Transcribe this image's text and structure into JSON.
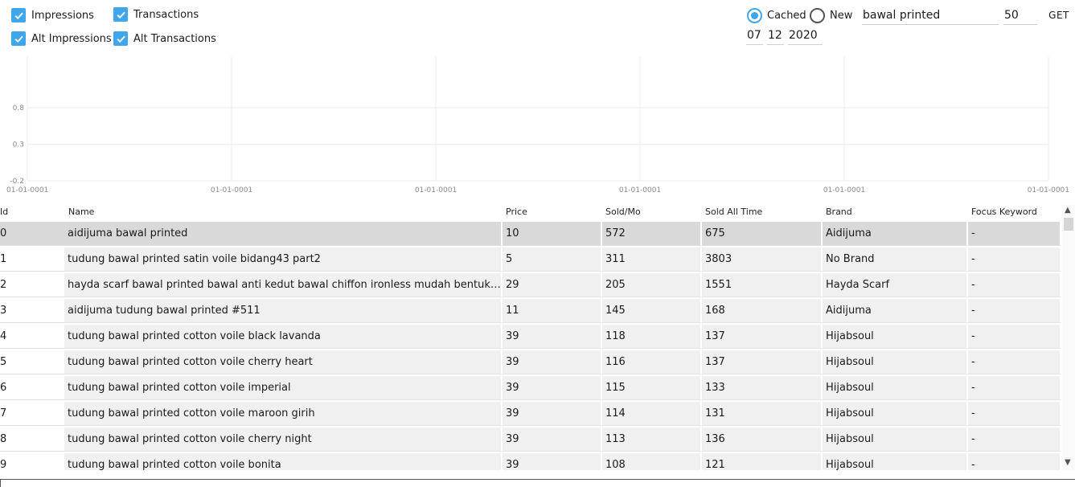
{
  "filters": {
    "impressions": {
      "label": "Impressions",
      "checked": true
    },
    "transactions": {
      "label": "Transactions",
      "checked": true
    },
    "alt_impressions": {
      "label": "Alt Impressions",
      "checked": true
    },
    "alt_transactions": {
      "label": "Alt Transactions",
      "checked": true
    }
  },
  "source": {
    "cached_label": "Cached",
    "new_label": "New",
    "selected": "cached"
  },
  "search": {
    "keyword": "bawal printed",
    "limit": "50",
    "get_label": "GET"
  },
  "date": {
    "day": "07",
    "month": "12",
    "year": "2020"
  },
  "chart_data": {
    "type": "line",
    "series": [],
    "y_ticks": [
      "0.8",
      "0.3",
      "-0.2"
    ],
    "x_ticks": [
      "01-01-0001",
      "01-01-0001",
      "01-01-0001",
      "01-01-0001",
      "01-01-0001",
      "01-01-0001"
    ],
    "ylim": [
      -0.2,
      1.0
    ],
    "grid": true
  },
  "table": {
    "headers": [
      "Id",
      "Name",
      "Price",
      "Sold/Mo",
      "Sold All Time",
      "Brand",
      "Focus Keyword"
    ],
    "rows": [
      [
        "0",
        "aidijuma bawal printed",
        "10",
        "572",
        "675",
        "Aidijuma",
        "-"
      ],
      [
        "1",
        "tudung bawal printed  satin voile bidang43 part2",
        "5",
        "311",
        "3803",
        "No Brand",
        "-"
      ],
      [
        "2",
        "hayda scarf bawal printed bawal anti kedut bawal chiffon ironless  mudah bentuk t...",
        "29",
        "205",
        "1551",
        "Hayda Scarf",
        "-"
      ],
      [
        "3",
        "aidijuma tudung bawal printed #511",
        "11",
        "145",
        "168",
        "Aidijuma",
        "-"
      ],
      [
        "4",
        "tudung bawal printed cotton voile black lavanda",
        "39",
        "118",
        "137",
        "Hijabsoul",
        "-"
      ],
      [
        "5",
        "tudung bawal printed cotton voile cherry heart",
        "39",
        "116",
        "137",
        "Hijabsoul",
        "-"
      ],
      [
        "6",
        "tudung bawal printed cotton voile imperial",
        "39",
        "115",
        "133",
        "Hijabsoul",
        "-"
      ],
      [
        "7",
        "tudung bawal printed cotton voile maroon girih",
        "39",
        "114",
        "131",
        "Hijabsoul",
        "-"
      ],
      [
        "8",
        "tudung bawal printed cotton voile cherry night",
        "39",
        "113",
        "136",
        "Hijabsoul",
        "-"
      ],
      [
        "9",
        "tudung bawal printed cotton voile bonita",
        "39",
        "108",
        "121",
        "Hijabsoul",
        "-"
      ]
    ],
    "selected_row": 0
  }
}
